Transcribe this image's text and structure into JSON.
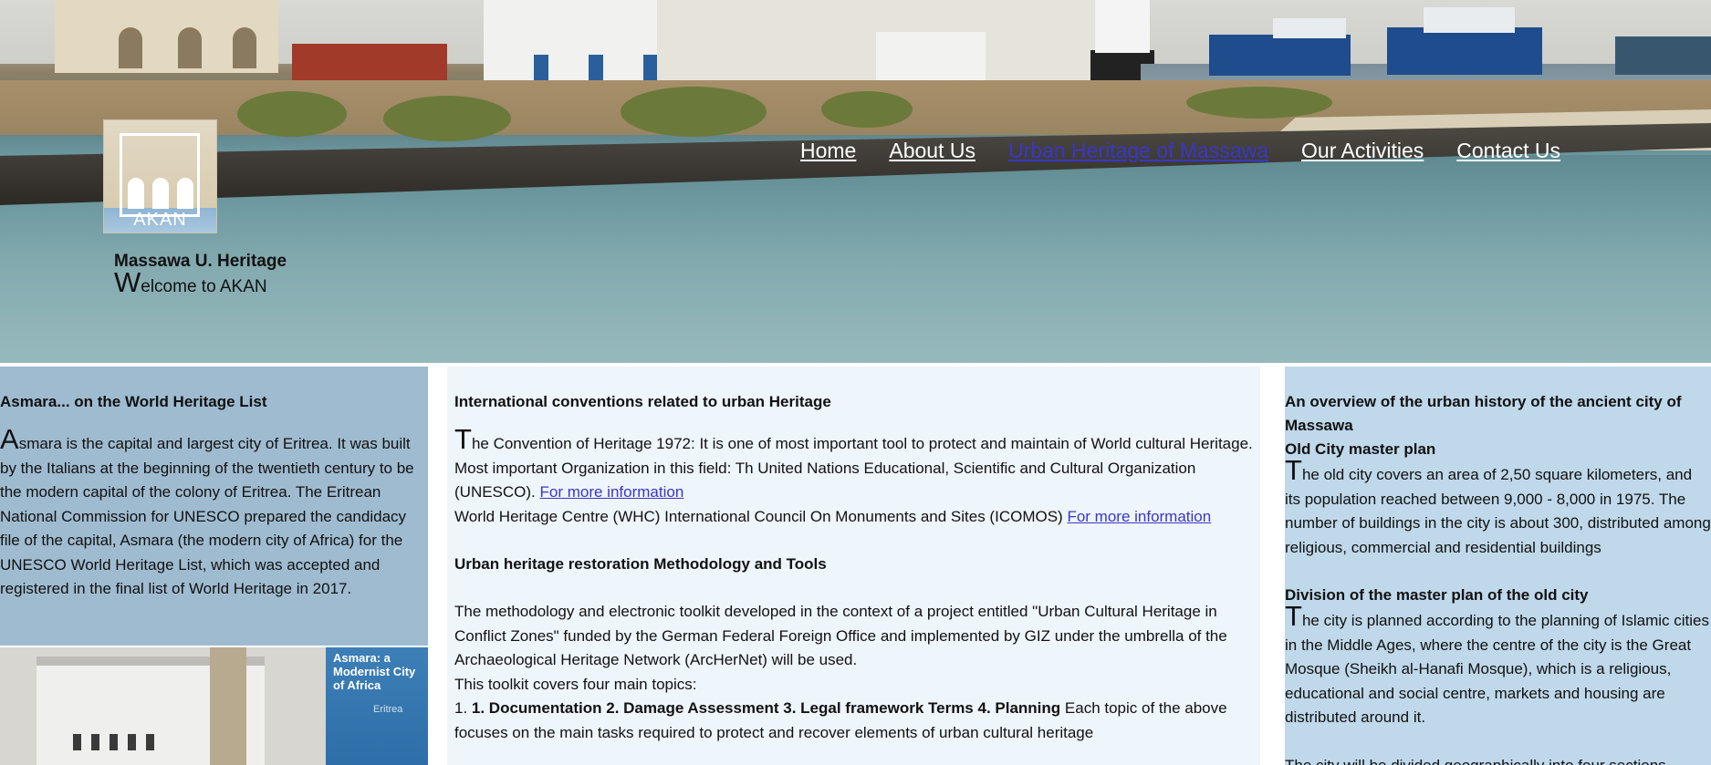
{
  "header": {
    "logo_text": "AKAN",
    "site_title": "Massawa U. Heritage",
    "welcome_cap": "W",
    "welcome_rest": "elcome to AKAN"
  },
  "nav": {
    "items": [
      {
        "label": "Home"
      },
      {
        "label": "About Us"
      },
      {
        "label": "Urban Heritage of Massawa"
      },
      {
        "label": "Our Activities"
      },
      {
        "label": "Contact Us"
      }
    ],
    "active_color": "#3a36c9"
  },
  "left": {
    "heading": "Asmara... on the World Heritage List",
    "body_cap": "A",
    "body_rest": "smara is the capital and largest city of Eritrea. It was built by the Italians at the beginning of the twentieth century to be the modern capital of the colony of Eritrea. The Eritrean National Commission for UNESCO prepared the candidacy file of the capital, Asmara (the modern city of Africa) for the UNESCO World Heritage List, which was accepted and registered in the final list of World Heritage in 2017.",
    "book_title": "Asmara: a Modernist City of Africa",
    "book_sub": "Eritrea"
  },
  "middle": {
    "heading1": "International conventions related to urban Heritage",
    "p1_cap": "T",
    "p1_rest": "he Convention of Heritage 1972: It is one of most important tool to protect and maintain of World cultural Heritage. Most important Organization in this field: Th United Nations Educational, Scientific and Cultural Organization (UNESCO). ",
    "link1": "For more information",
    "p2": "World Heritage Centre (WHC) International Council On Monuments and Sites (ICOMOS) ",
    "link2": "For more information",
    "heading2": "Urban heritage restoration Methodology and Tools",
    "p3": "The methodology and electronic toolkit developed in the context of a project entitled \"Urban Cultural Heritage in Conflict Zones\" funded by the German Federal Foreign Office and implemented by GIZ under the umbrella of the Archaeological Heritage Network (ArcHerNet) will be used.",
    "p4": "This toolkit covers four main topics:",
    "p5_prefix": "1. ",
    "p5_bold": "1. Documentation 2. Damage Assessment 3. Legal framework Terms 4. Planning",
    "p5_rest": " Each topic of the above focuses on the main tasks required to protect and recover elements of urban cultural heritage"
  },
  "right": {
    "heading": "An overview of the urban history of the ancient city of Massawa",
    "sub1": "Old City master plan",
    "p1_cap": "T",
    "p1_rest": "he old city covers an area of 2,50 square kilometers, and its population reached between 9,000 - 8,000 in 1975. The number of buildings in the city is about 300, distributed among religious, commercial and residential buildings",
    "sub2": "Division of the master plan of the old city",
    "p2_cap": "T",
    "p2_rest": "he city is planned according to the planning of Islamic cities in the Middle Ages, where the centre of the city is the Great Mosque (Sheikh al-Hanafi Mosque), which is a religious, educational and social centre, markets and housing are distributed around it.",
    "p3": "The city will be divided geographically into four sections"
  }
}
